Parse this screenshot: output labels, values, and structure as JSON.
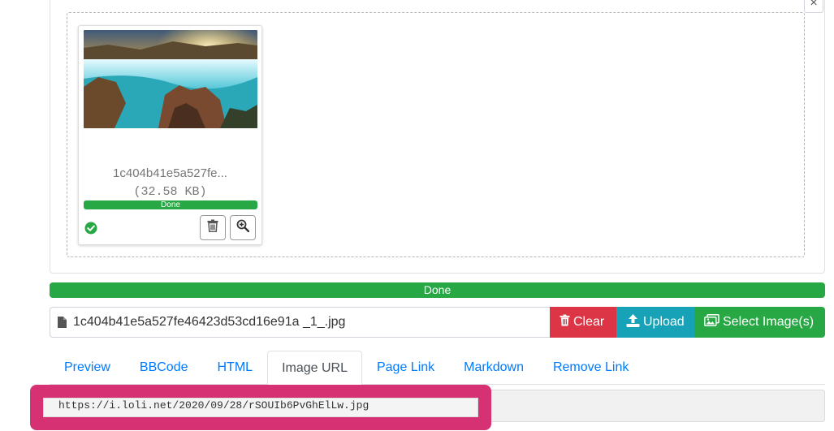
{
  "close_label": "×",
  "thumbnail": {
    "file_name": "1c404b41e5a527fe...",
    "file_size": "(32.58 KB)",
    "progress_label": "Done",
    "progress_percent": 100,
    "icons": [
      "check-circle-icon",
      "trash-icon",
      "zoom-in-icon"
    ]
  },
  "main_progress": {
    "label": "Done",
    "percent": 100
  },
  "file_input": {
    "value": "1c404b41e5a527fe46423d53cd16e91a _1_.jpg",
    "icon": "file-icon"
  },
  "buttons": {
    "clear": "Clear",
    "upload": "Upload",
    "select": "Select Image(s)"
  },
  "tabs": [
    {
      "label": "Preview"
    },
    {
      "label": "BBCode"
    },
    {
      "label": "HTML"
    },
    {
      "label": "Image URL",
      "active": true
    },
    {
      "label": "Page Link"
    },
    {
      "label": "Markdown"
    },
    {
      "label": "Remove Link"
    }
  ],
  "output": {
    "url": "https://i.loli.net/2020/09/28/rSOUIb6PvGhElLw.jpg"
  },
  "colors": {
    "success": "#28a745",
    "danger": "#dc3545",
    "info": "#17a2b8",
    "link": "#007bff",
    "highlight": "#d63173"
  }
}
